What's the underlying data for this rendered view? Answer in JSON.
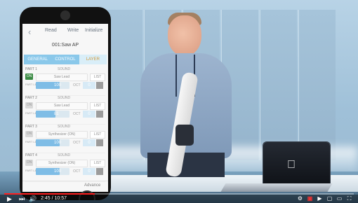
{
  "phone_ui": {
    "nav": {
      "back_icon": "chevron-left-icon",
      "read_label": "Read",
      "write_label": "Write",
      "initialize_label": "Initialize"
    },
    "patch_title": "001:Saw AP",
    "tabs": [
      {
        "label": "GENERAL"
      },
      {
        "label": "CONTROL"
      },
      {
        "label": "LAYER",
        "active": true
      }
    ],
    "parts": [
      {
        "name": "PART 1",
        "sound_label": "SOUND",
        "on_label": "ON",
        "on_active": true,
        "sound_value": "Saw Lead",
        "list_label": "LIST",
        "level_label": "PART LEVEL",
        "level_value": "100",
        "level_fraction": 0.7,
        "oct_label": "OCT",
        "oct_value": "0"
      },
      {
        "name": "PART 2",
        "sound_label": "SOUND",
        "on_label": "ON",
        "on_active": false,
        "sound_value": "Saw Lead",
        "list_label": "LIST",
        "level_label": "PART LEVEL",
        "level_value": "81",
        "level_fraction": 0.58,
        "oct_label": "OCT",
        "oct_value": "0"
      },
      {
        "name": "PART 3",
        "sound_label": "SOUND",
        "on_label": "ON",
        "on_active": false,
        "sound_value": "Synthesizer (ON)",
        "list_label": "LIST",
        "level_label": "PART LEVEL",
        "level_value": "100",
        "level_fraction": 0.7,
        "oct_label": "OCT",
        "oct_value": "0"
      },
      {
        "name": "PART 4",
        "sound_label": "SOUND",
        "on_label": "ON",
        "on_active": false,
        "sound_value": "Synthesizer (ON)",
        "list_label": "LIST",
        "level_label": "PART LEVEL",
        "level_value": "100",
        "level_fraction": 0.7,
        "oct_label": "OCT",
        "oct_value": "0"
      }
    ],
    "bottom": {
      "left": "",
      "mid": "",
      "advance_label": "Advance"
    }
  },
  "player": {
    "progress_fraction": 0.26,
    "time_text": "2:45 / 10:57",
    "controls": {
      "play_icon": "play-icon",
      "next_icon": "next-icon",
      "volume_icon": "volume-icon",
      "right_icons": [
        "settings-icon",
        "subtitles-icon",
        "youtube-logo-icon",
        "miniplayer-icon",
        "theater-icon",
        "fullscreen-icon"
      ]
    }
  }
}
